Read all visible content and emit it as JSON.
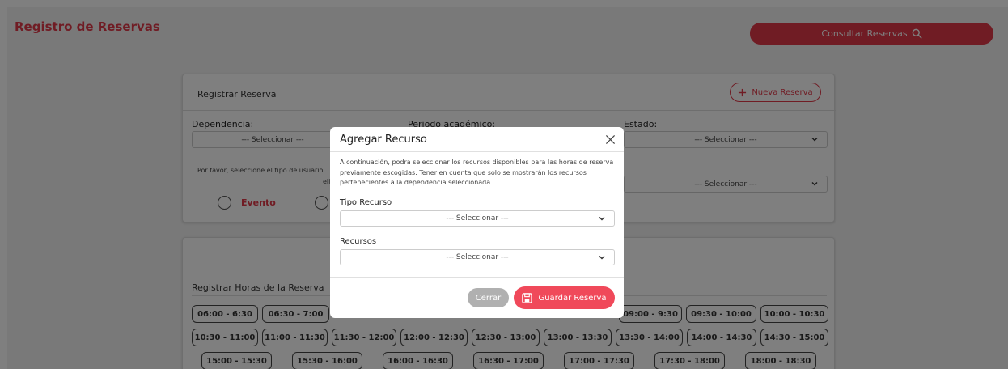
{
  "app": {
    "title": "Registro de Reservas",
    "consult_button": "Consultar Reservas"
  },
  "register_card": {
    "title": "Registrar Reserva",
    "new_button": "Nueva Reserva",
    "dependencia_label": "Dependencia:",
    "dependencia_value": "--- Seleccionar ---",
    "periodo_label": "Periodo académico:",
    "estado_label": "Estado:",
    "estado_value": "--- Seleccionar ---",
    "user_type_hint_line1": "Por favor, seleccione el tipo de usuario",
    "user_type_hint_line2": "elij",
    "second_select_value": "--- Seleccionar ---",
    "radio_evento": "Evento"
  },
  "hours_card": {
    "title": "Registrar Horas de la Reserva",
    "row1": [
      "06:00 - 6:30",
      "06:30 - 7:00",
      "09:00 - 9:30",
      "09:30 - 10:00",
      "10:00 - 10:30"
    ],
    "row2": [
      "10:30 - 11:00",
      "11:00 - 11:30",
      "11:30 - 12:00",
      "12:00 - 12:30",
      "12:30 - 13:00",
      "13:00 - 13:30",
      "13:30 - 14:00",
      "14:00 - 14:30",
      "14:30 - 15:00"
    ],
    "row3": [
      "15:00 - 15:30",
      "15:30 - 16:00",
      "16:00 - 16:30",
      "16:30 - 17:00",
      "17:00 - 17:30",
      "17:30 - 18:00",
      "18:00 - 18:30"
    ]
  },
  "modal": {
    "title": "Agregar Recurso",
    "description": "A continuación, podra seleccionar los recursos disponibles para las horas de reserva previamente escogidas. Tener en cuenta que solo se mostrarán los recursos pertenecientes a la dependencia seleccionada.",
    "tipo_label": "Tipo Recurso",
    "tipo_value": "--- Seleccionar ---",
    "recursos_label": "Recursos",
    "recursos_value": "--- Seleccionar ---",
    "close_button": "Cerrar",
    "save_button": "Guardar Reserva"
  },
  "colors": {
    "accent": "#e03848",
    "save": "#f0495a",
    "overlay": "rgba(0,0,0,0.5)"
  },
  "icons": [
    "search-icon",
    "plus-icon",
    "chevron-down-icon",
    "close-icon",
    "save-icon"
  ]
}
